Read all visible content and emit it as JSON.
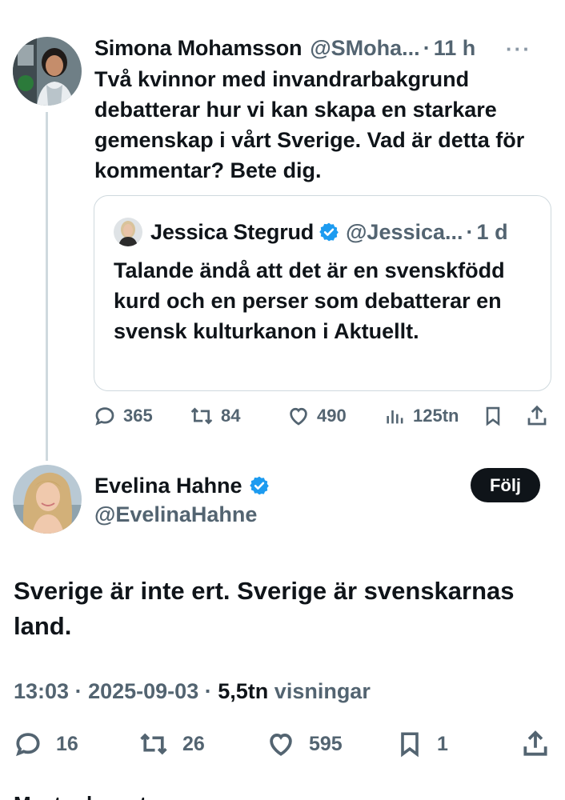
{
  "reply": {
    "author_name": "Simona Mohamsson",
    "author_handle": "@SMoha...",
    "separator": "·",
    "time": "11 h",
    "more_icon": "more-dots-icon",
    "text": "Två kvinnor med invandrarbakgrund debatterar hur vi kan skapa en starkare gemenskap i vårt Sverige. Vad är detta för kommentar? Bete dig.",
    "quote": {
      "author_name": "Jessica Stegrud",
      "author_handle": "@Jessica...",
      "separator": "·",
      "time": "1 d",
      "verified": true,
      "text": "Talande ändå att det är en svenskfödd kurd och en perser som debatterar en svensk kulturkanon i Aktuellt."
    },
    "actions": {
      "replies": "365",
      "reposts": "84",
      "likes": "490",
      "views": "125tn"
    }
  },
  "main": {
    "author_name": "Evelina Hahne",
    "author_handle": "@EvelinaHahne",
    "verified": true,
    "follow_label": "Följ",
    "text": "Sverige är inte ert. Sverige är svenskarnas land.",
    "meta": {
      "time": "13:03",
      "date": "2025-09-03",
      "separator": "·",
      "views_count": "5,5tn",
      "views_label": "visningar"
    },
    "actions": {
      "replies": "16",
      "reposts": "26",
      "likes": "595",
      "bookmarks": "1"
    }
  },
  "colors": {
    "text": "#0f1419",
    "secondary": "#536471",
    "border": "#cfd9de",
    "verified": "#1d9bf0",
    "button_bg": "#0f1419"
  },
  "footer_partial_text": "Mest relevanta svaren"
}
